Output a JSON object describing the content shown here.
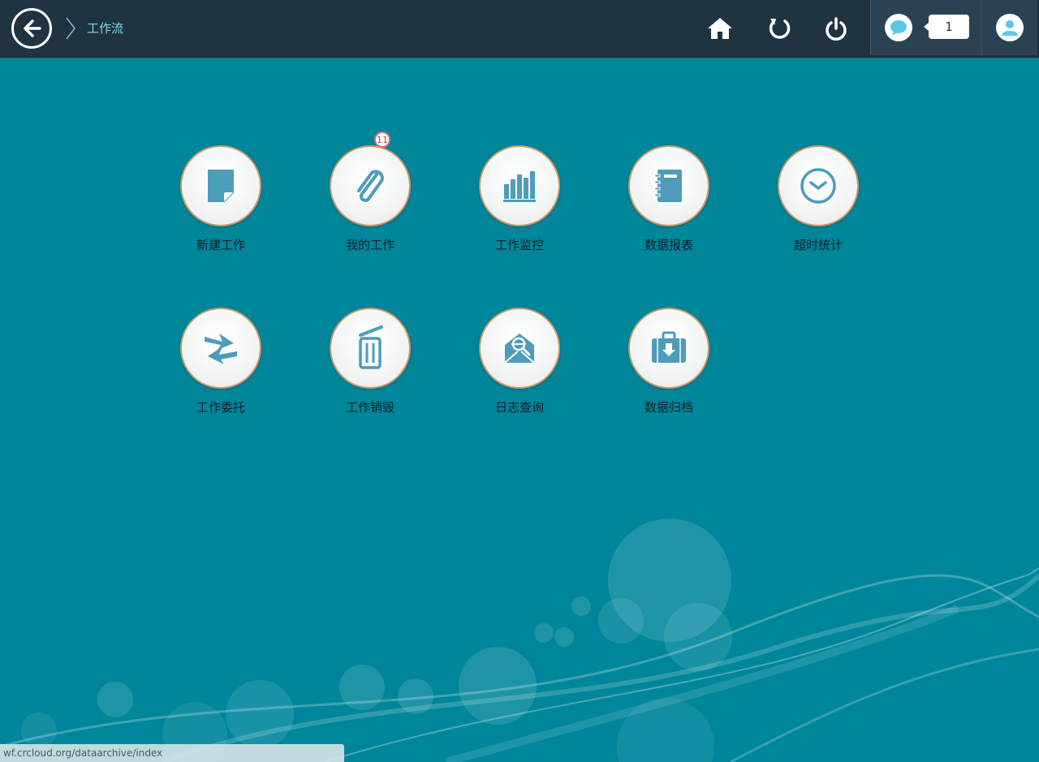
{
  "header": {
    "breadcrumb": "工作流",
    "message_count": "1"
  },
  "apps": [
    {
      "label": "新建工作",
      "icon": "new-document-icon"
    },
    {
      "label": "我的工作",
      "icon": "paperclip-icon",
      "badge": "11"
    },
    {
      "label": "工作监控",
      "icon": "bar-chart-icon"
    },
    {
      "label": "数据报表",
      "icon": "notebook-icon"
    },
    {
      "label": "超时统计",
      "icon": "clock-icon"
    },
    {
      "label": "工作委托",
      "icon": "exchange-arrows-icon"
    },
    {
      "label": "工作销毁",
      "icon": "trash-can-icon"
    },
    {
      "label": "日志查询",
      "icon": "envelope-search-icon"
    },
    {
      "label": "数据归档",
      "icon": "archive-briefcase-icon"
    }
  ],
  "status_bar": {
    "url": "wf.crcloud.org/dataarchive/index"
  },
  "colors": {
    "background": "#00869b",
    "topbar": "#1f3341",
    "icon_blue": "#4d9cba",
    "badge_red": "#c23a4a"
  }
}
